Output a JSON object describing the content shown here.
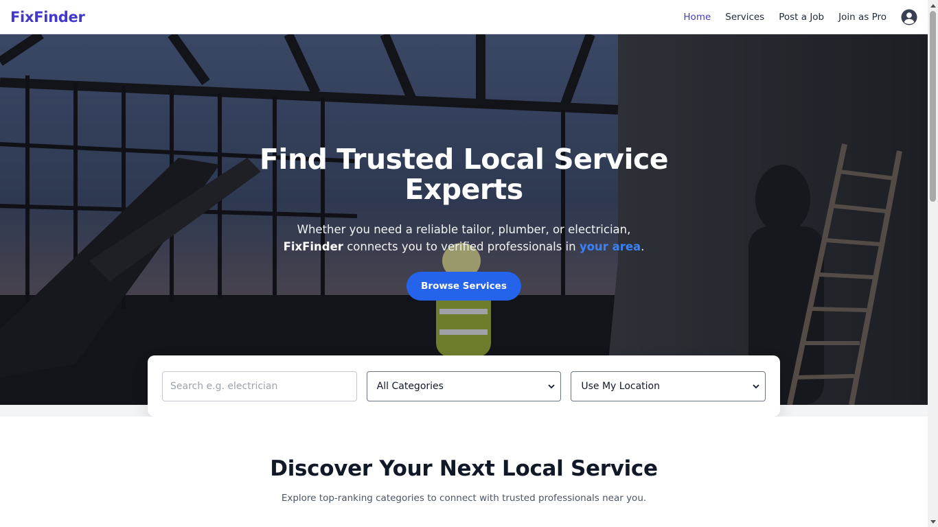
{
  "navbar": {
    "brand": "FixFinder",
    "links": [
      {
        "label": "Home",
        "active": true
      },
      {
        "label": "Services",
        "active": false
      },
      {
        "label": "Post a Job",
        "active": false
      },
      {
        "label": "Join as Pro",
        "active": false
      }
    ],
    "user_icon": "user-circle-icon"
  },
  "hero": {
    "title": "Find Trusted Local Service Experts",
    "subtitle_part1": "Whether you need a reliable tailor, plumber, or electrician, ",
    "subtitle_brand": "FixFinder",
    "subtitle_part2": " connects you to verified professionals in ",
    "subtitle_accent": "your area",
    "subtitle_end": ".",
    "cta_label": "Browse Services"
  },
  "search": {
    "placeholder": "Search e.g. electrician",
    "category_selected": "All Categories",
    "location_selected": "Use My Location"
  },
  "discover": {
    "title": "Discover Your Next Local Service",
    "subtitle": "Explore top-ranking categories to connect with trusted professionals near you."
  },
  "colors": {
    "brand": "#4338ca",
    "accent": "#2563eb",
    "accent_text": "#3b82f6"
  }
}
